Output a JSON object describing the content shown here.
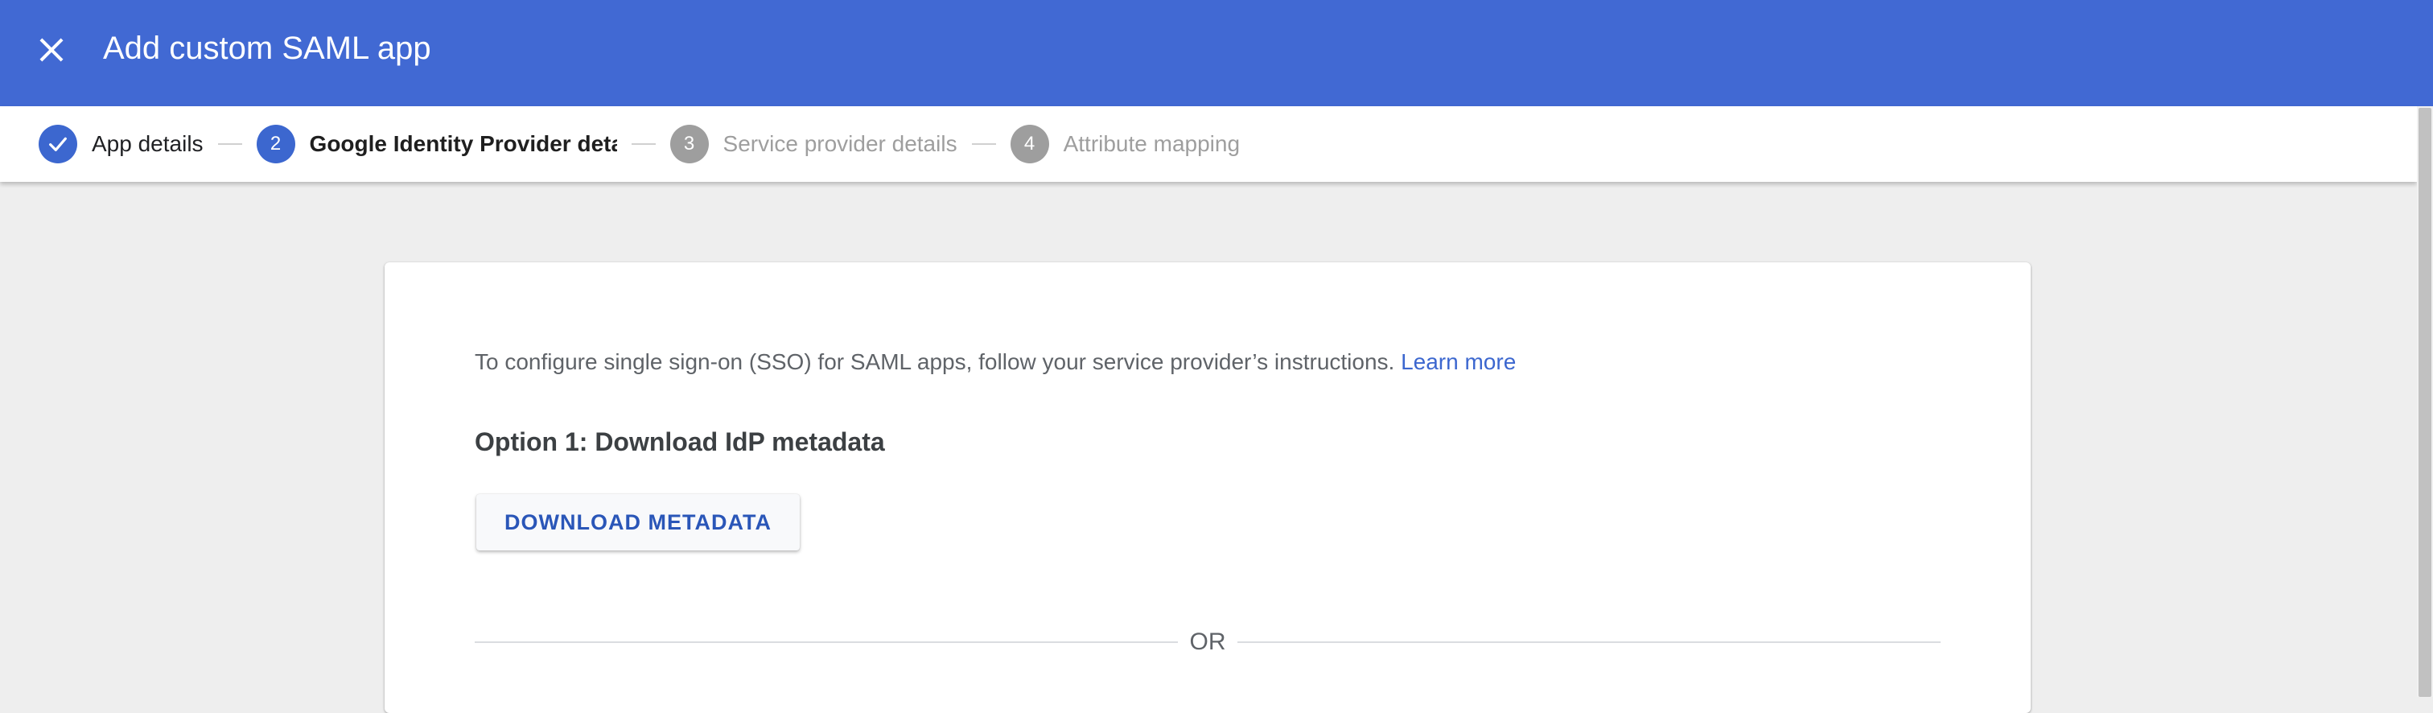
{
  "header": {
    "title": "Add custom SAML app",
    "close_icon": "close-icon",
    "background_color": "#4169d3"
  },
  "stepper": {
    "steps": [
      {
        "number": "",
        "label": "App details",
        "state": "completed",
        "icon": "check-icon"
      },
      {
        "number": "2",
        "label": "Google Identity Provider detail:",
        "state": "active"
      },
      {
        "number": "3",
        "label": "Service provider details",
        "state": "pending"
      },
      {
        "number": "4",
        "label": "Attribute mapping",
        "state": "pending"
      }
    ]
  },
  "content": {
    "intro_text": "To configure single sign-on (SSO) for SAML apps, follow your service provider’s instructions.",
    "learn_more": "Learn more",
    "option1_heading": "Option 1: Download IdP metadata",
    "download_button": "DOWNLOAD METADATA",
    "or_text": "OR"
  },
  "colors": {
    "accent": "#3c67cf",
    "pending_step": "#9e9e9e",
    "page_background": "#eeeeee"
  }
}
